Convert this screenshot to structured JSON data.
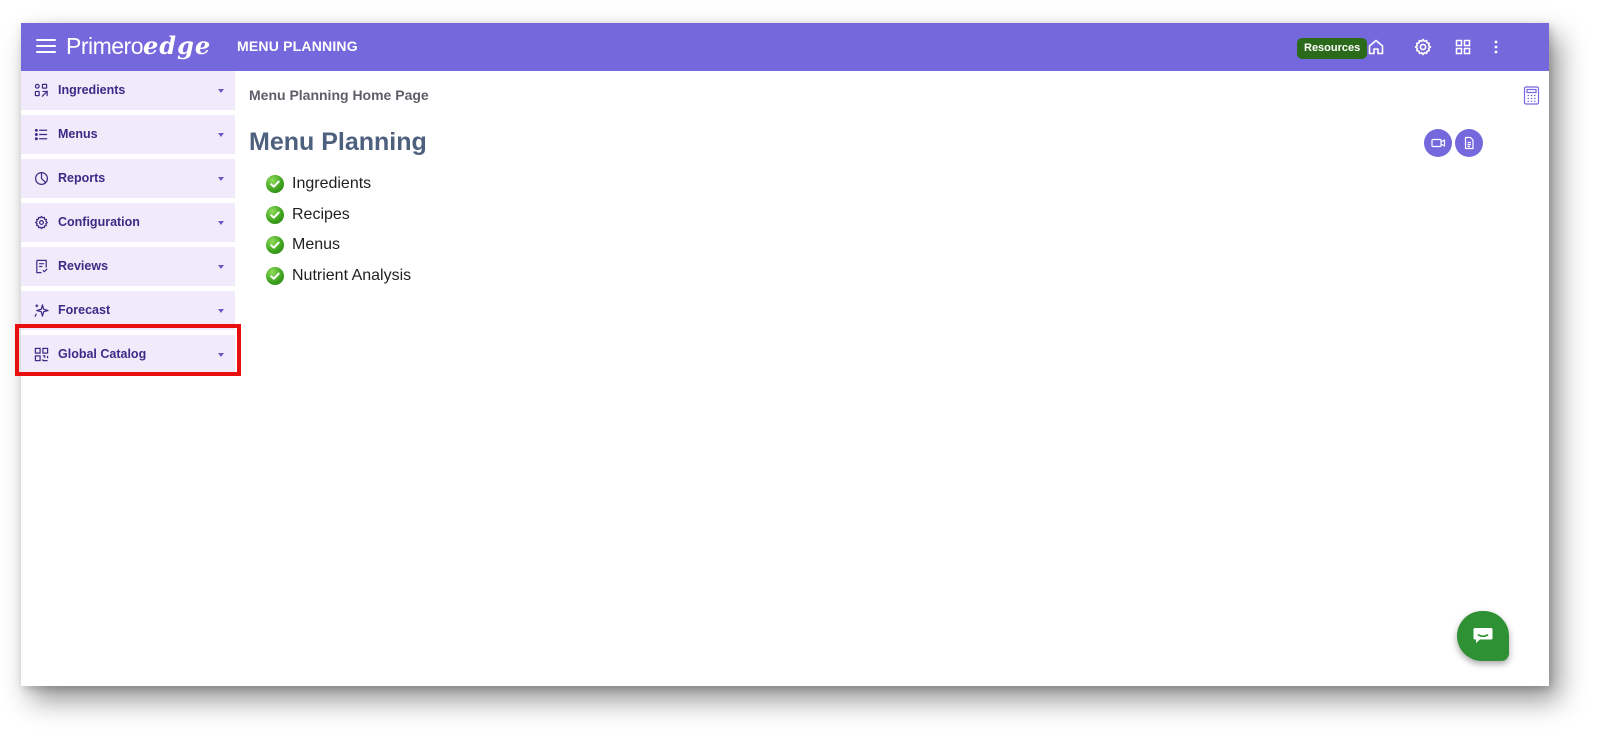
{
  "topbar": {
    "brand_primary": "Primero",
    "brand_secondary": "edge",
    "app_title": "MENU PLANNING",
    "resources_label": "Resources",
    "icons": [
      "hamburger-icon",
      "home-icon",
      "gear-icon",
      "apps-grid-icon",
      "more-vertical-icon"
    ]
  },
  "sidebar": {
    "items": [
      {
        "label": "Ingredients",
        "icon": "ingredients-icon"
      },
      {
        "label": "Menus",
        "icon": "list-icon"
      },
      {
        "label": "Reports",
        "icon": "pie-chart-icon"
      },
      {
        "label": "Configuration",
        "icon": "gear-icon"
      },
      {
        "label": "Reviews",
        "icon": "review-icon"
      },
      {
        "label": "Forecast",
        "icon": "sparkle-icon"
      },
      {
        "label": "Global Catalog",
        "icon": "qr-grid-icon"
      }
    ]
  },
  "main": {
    "breadcrumb": "Menu Planning Home Page",
    "title": "Menu Planning",
    "features": [
      "Ingredients",
      "Recipes",
      "Menus",
      "Nutrient Analysis"
    ]
  },
  "colors": {
    "accent": "#7468dc",
    "sidebar_bg": "#f0eafb",
    "sidebar_text": "#3d2a86",
    "resources_bg": "#2c6a1b",
    "chat_bg": "#2e9134",
    "highlight": "#e80f0f"
  }
}
